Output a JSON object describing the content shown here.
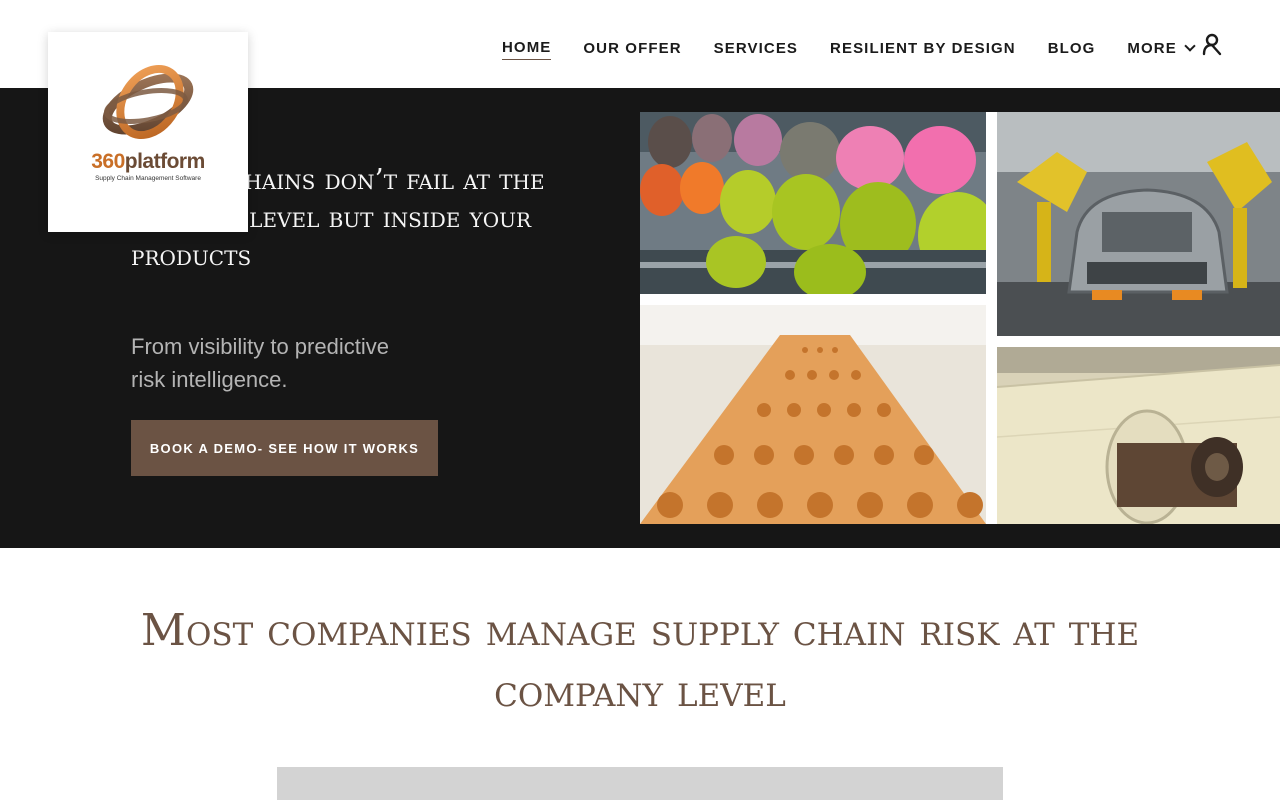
{
  "header": {
    "logo": {
      "wordmark_number": "360",
      "wordmark_text": "platform",
      "tagline": "Supply Chain Management Software"
    },
    "nav": [
      {
        "label": "HOME",
        "active": true
      },
      {
        "label": "OUR OFFER"
      },
      {
        "label": "SERVICES"
      },
      {
        "label": "RESILIENT BY DESIGN"
      },
      {
        "label": "BLOG"
      },
      {
        "label": "MORE",
        "icon": "chevron-down-icon"
      }
    ],
    "account_icon": "user-icon"
  },
  "hero": {
    "title": "Supply chains don’t fail at the company level but inside your products",
    "subtitle": "From visibility to predictive risk intelligence.",
    "cta_label": "BOOK A DEMO- SEE HOW IT WORKS",
    "images": [
      "textile-yarn-spools",
      "car-assembly-robots",
      "biscuit-production-line",
      "paper-rolls-machine"
    ]
  },
  "section": {
    "title": "Most companies manage supply chain risk at the company level"
  },
  "colors": {
    "accent_brown": "#6b5344",
    "hero_background": "#161616",
    "logo_orange": "#c96f27"
  }
}
